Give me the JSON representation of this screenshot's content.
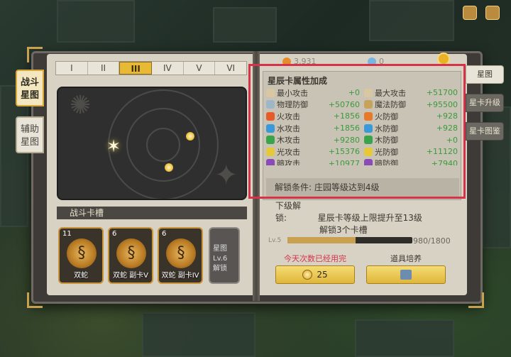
{
  "resources": {
    "coins": "3,931",
    "gems": "0"
  },
  "roman_tabs": [
    "I",
    "II",
    "III",
    "IV",
    "V",
    "VI"
  ],
  "roman_active_index": 2,
  "left_side_tabs": [
    {
      "label_line1": "战斗",
      "label_line2": "星图",
      "active": true
    },
    {
      "label_line1": "辅助",
      "label_line2": "星图",
      "active": false
    }
  ],
  "battle_slot": {
    "title": "战斗卡槽",
    "cards": [
      {
        "level": "11",
        "name": "双蛇"
      },
      {
        "level": "6",
        "name": "双蛇 副卡V"
      },
      {
        "level": "6",
        "name": "双蛇 副卡IV"
      }
    ],
    "locked_card": {
      "text_line1": "星图Lv.6",
      "text_line2": "解锁"
    }
  },
  "attributes": {
    "title": "星辰卡属性加成",
    "items": [
      {
        "name": "最小攻击",
        "value": "+0",
        "icon_color": "#d8c7a0"
      },
      {
        "name": "最大攻击",
        "value": "+51700",
        "icon_color": "#d8c7a0"
      },
      {
        "name": "物理防御",
        "value": "+50760",
        "icon_color": "#9fb6c9"
      },
      {
        "name": "魔法防御",
        "value": "+95500",
        "icon_color": "#c7a25a"
      },
      {
        "name": "火攻击",
        "value": "+1856",
        "icon_color": "#e65b2a"
      },
      {
        "name": "火防御",
        "value": "+928",
        "icon_color": "#e67a2a"
      },
      {
        "name": "水攻击",
        "value": "+1856",
        "icon_color": "#3a9ad9"
      },
      {
        "name": "水防御",
        "value": "+928",
        "icon_color": "#3a9ad9"
      },
      {
        "name": "木攻击",
        "value": "+9280",
        "icon_color": "#3aa44a"
      },
      {
        "name": "木防御",
        "value": "+0",
        "icon_color": "#3aa44a"
      },
      {
        "name": "光攻击",
        "value": "+15376",
        "icon_color": "#e6c93a"
      },
      {
        "name": "光防御",
        "value": "+11120",
        "icon_color": "#e6c93a"
      },
      {
        "name": "暗攻击",
        "value": "+10977",
        "icon_color": "#8a4ab8"
      },
      {
        "name": "暗防御",
        "value": "+7940",
        "icon_color": "#8a4ab8"
      }
    ],
    "unlock_condition": "解锁条件:  庄园等级达到4级"
  },
  "next_unlock": {
    "label": "下级解锁:",
    "line1": "星辰卡等级上限提升至13级",
    "line2": "解锁3个卡槽"
  },
  "level": {
    "label": "Lv.5",
    "current": 980,
    "max": 1800,
    "text": "980/1800"
  },
  "buttons": {
    "upgrade": {
      "caption": "今天次数已经用完",
      "label": "25",
      "caption_color": "#d6334a"
    },
    "item_train": {
      "caption": "道具培养",
      "caption_color": "#3b372f"
    }
  },
  "right_side_tabs": [
    {
      "label": "星图",
      "active": true
    },
    {
      "label": "星卡升级",
      "active": false
    },
    {
      "label": "星卡图鉴",
      "active": false
    }
  ]
}
